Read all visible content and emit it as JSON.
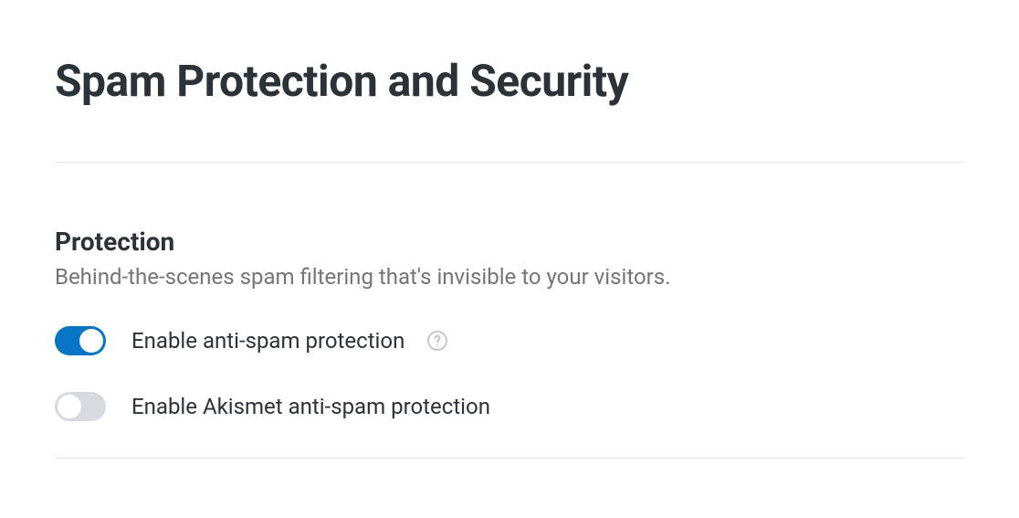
{
  "page": {
    "title": "Spam Protection and Security"
  },
  "section_protection": {
    "heading": "Protection",
    "description": "Behind-the-scenes spam filtering that's invisible to your visitors."
  },
  "toggles": {
    "anti_spam": {
      "label": "Enable anti-spam protection",
      "enabled": true
    },
    "akismet": {
      "label": "Enable Akismet anti-spam protection",
      "enabled": false
    }
  }
}
